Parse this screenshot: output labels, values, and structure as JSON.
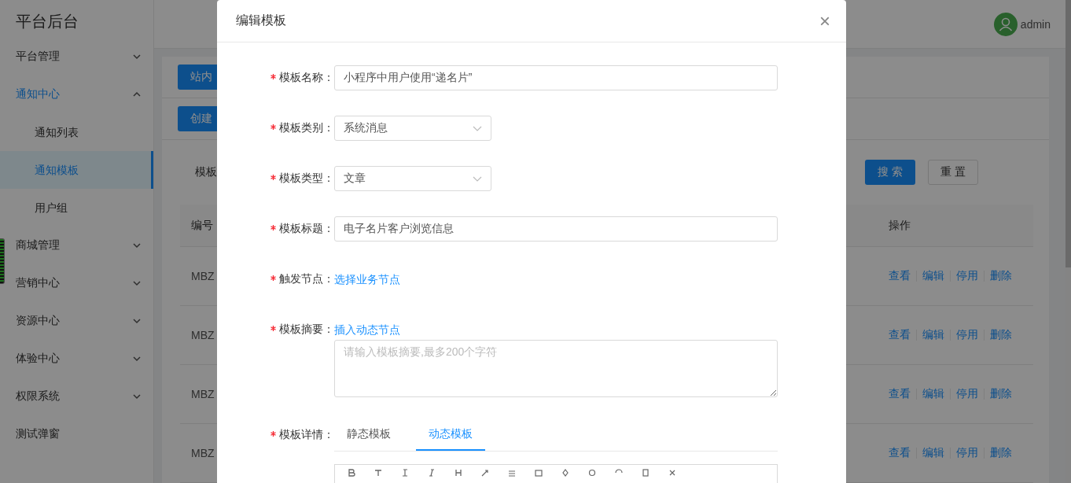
{
  "sidebar": {
    "title": "平台后台",
    "items": [
      {
        "kind": "group",
        "label": "平台管理",
        "expanded": false,
        "selected": false
      },
      {
        "kind": "group",
        "label": "通知中心",
        "expanded": true,
        "selected": true,
        "children": [
          {
            "label": "通知列表",
            "selected": false
          },
          {
            "label": "通知模板",
            "selected": true
          },
          {
            "label": "用户组",
            "selected": false
          }
        ]
      },
      {
        "kind": "group",
        "label": "商城管理",
        "expanded": false,
        "selected": false
      },
      {
        "kind": "group",
        "label": "营销中心",
        "expanded": false,
        "selected": false
      },
      {
        "kind": "group",
        "label": "资源中心",
        "expanded": false,
        "selected": false
      },
      {
        "kind": "group",
        "label": "体验中心",
        "expanded": false,
        "selected": false
      },
      {
        "kind": "group",
        "label": "权限系统",
        "expanded": false,
        "selected": false
      },
      {
        "kind": "link",
        "label": "测试弹窗",
        "selected": false
      }
    ]
  },
  "header": {
    "user": "admin"
  },
  "page": {
    "tab_button": "站内",
    "create_button": "创建",
    "filter_label": "模板",
    "search_button": "搜 索",
    "reset_button": "重 置",
    "table": {
      "columns": [
        "编号",
        "操作"
      ],
      "rows": [
        {
          "code": "MBZ",
          "actions": [
            "查看",
            "编辑",
            "停用",
            "删除"
          ]
        },
        {
          "code": "MBZ",
          "actions": [
            "查看",
            "编辑",
            "停用",
            "删除"
          ]
        },
        {
          "code": "MBZ",
          "actions": [
            "查看",
            "编辑",
            "停用",
            "删除"
          ]
        },
        {
          "code": "MBZ",
          "actions": [
            "查看",
            "编辑",
            "停用",
            "删除"
          ]
        }
      ]
    }
  },
  "modal": {
    "title": "编辑模板",
    "close": "×",
    "fields": [
      {
        "kind": "input",
        "label": "模板名称：",
        "required": true,
        "value": "小程序中用户使用“递名片”"
      },
      {
        "kind": "select",
        "label": "模板类别：",
        "required": true,
        "value": "系统消息"
      },
      {
        "kind": "select",
        "label": "模板类型：",
        "required": true,
        "value": "文章"
      },
      {
        "kind": "input",
        "label": "模板标题：",
        "required": true,
        "value": "电子名片客户浏览信息"
      },
      {
        "kind": "link",
        "label": "触发节点：",
        "required": true,
        "link": "选择业务节点"
      },
      {
        "kind": "textarea",
        "label": "模板摘要：",
        "required": true,
        "link": "插入动态节点",
        "placeholder": "请输入模板摘要,最多200个字符"
      },
      {
        "kind": "tabs",
        "label": "模板详情：",
        "required": true,
        "tabs": [
          {
            "label": "静态模板",
            "selected": false
          },
          {
            "label": "动态模板",
            "selected": true
          }
        ]
      }
    ]
  }
}
